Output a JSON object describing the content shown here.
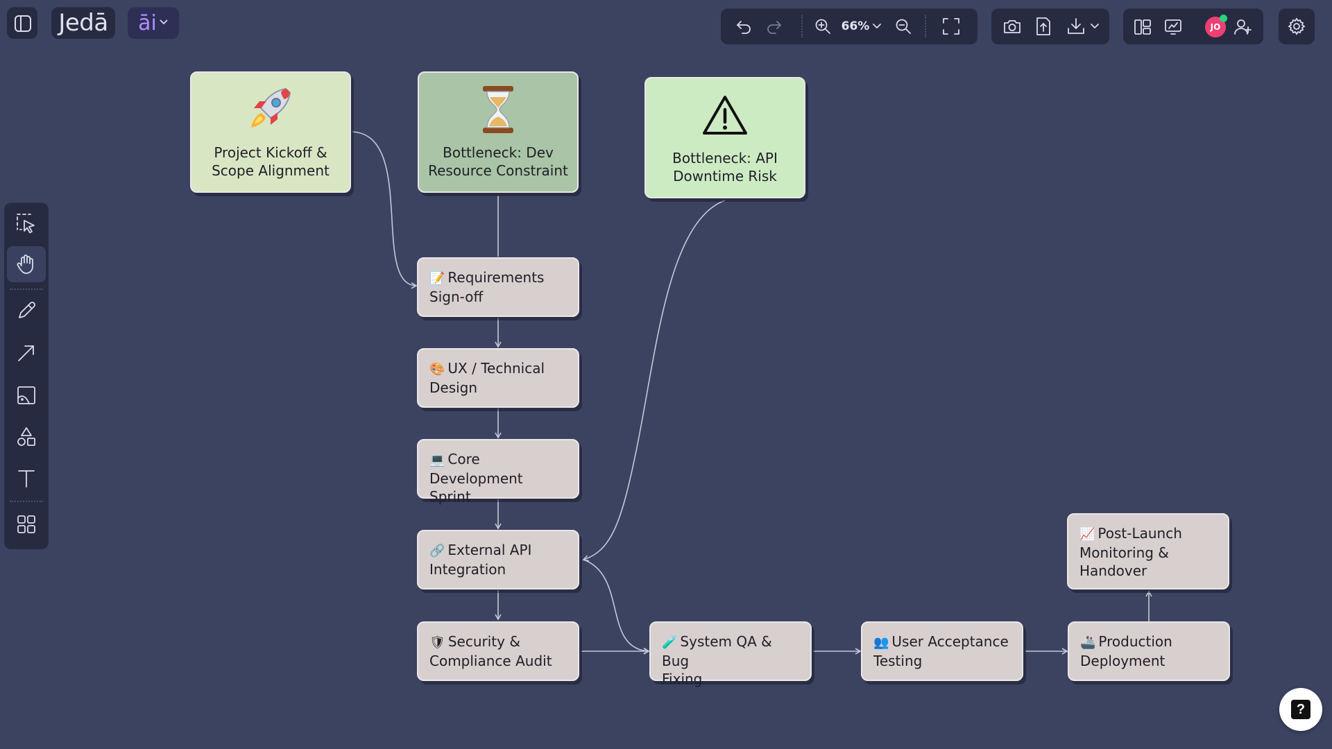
{
  "app": {
    "logo_text": "Jedā",
    "ai_label": "āi"
  },
  "toolbar": {
    "zoom_label": "66%",
    "avatar_initials": "JO"
  },
  "colors": {
    "canvas": "#3b4360",
    "panel": "#262b42",
    "kickoff_fill": "#d9e6c4",
    "dev_fill": "#a9c4a6",
    "api_fill": "#cdebc3",
    "step_fill": "#d8cfcf",
    "connector": "#c7c8d8",
    "avatar": "#ef3f72",
    "presence": "#2fd07a"
  },
  "side_tools": [
    {
      "name": "select-tool",
      "icon": "select-icon"
    },
    {
      "name": "hand-tool",
      "icon": "hand-icon"
    },
    {
      "name": "pencil-tool",
      "icon": "pencil-icon"
    },
    {
      "name": "arrow-tool",
      "icon": "arrow-icon"
    },
    {
      "name": "image-tool",
      "icon": "image-icon"
    },
    {
      "name": "shapes-tool",
      "icon": "shapes-icon"
    },
    {
      "name": "text-tool",
      "icon": "text-icon"
    },
    {
      "name": "templates-tool",
      "icon": "grid-icon"
    }
  ],
  "nodes": {
    "kickoff": {
      "icon": "rocket-icon",
      "title": "Project Kickoff &\nScope Alignment"
    },
    "dev_bottleneck": {
      "icon": "hourglass-icon",
      "title": "Bottleneck: Dev\nResource Constraint"
    },
    "api_bottleneck": {
      "icon": "warning-icon",
      "title": "Bottleneck: API\nDowntime Risk"
    },
    "requirements": {
      "emoji": "📝",
      "title": "Requirements\nSign-off"
    },
    "design": {
      "emoji": "🎨",
      "title": "UX / Technical\nDesign"
    },
    "development": {
      "emoji": "💻",
      "title": "Core Development\nSprint"
    },
    "api_integration": {
      "emoji": "🔗",
      "title": "External API\nIntegration"
    },
    "security": {
      "emoji": "🛡",
      "title": "Security &\nCompliance Audit"
    },
    "qa": {
      "emoji": "🧪",
      "title": "System QA & Bug\nFixing"
    },
    "uat": {
      "emoji": "👥",
      "title": "User Acceptance\nTesting"
    },
    "deployment": {
      "emoji": "🚢",
      "title": "Production\nDeployment"
    },
    "monitoring": {
      "emoji": "📈",
      "title": "Post-Launch\nMonitoring &\nHandover"
    }
  },
  "help": {
    "label": "?"
  }
}
